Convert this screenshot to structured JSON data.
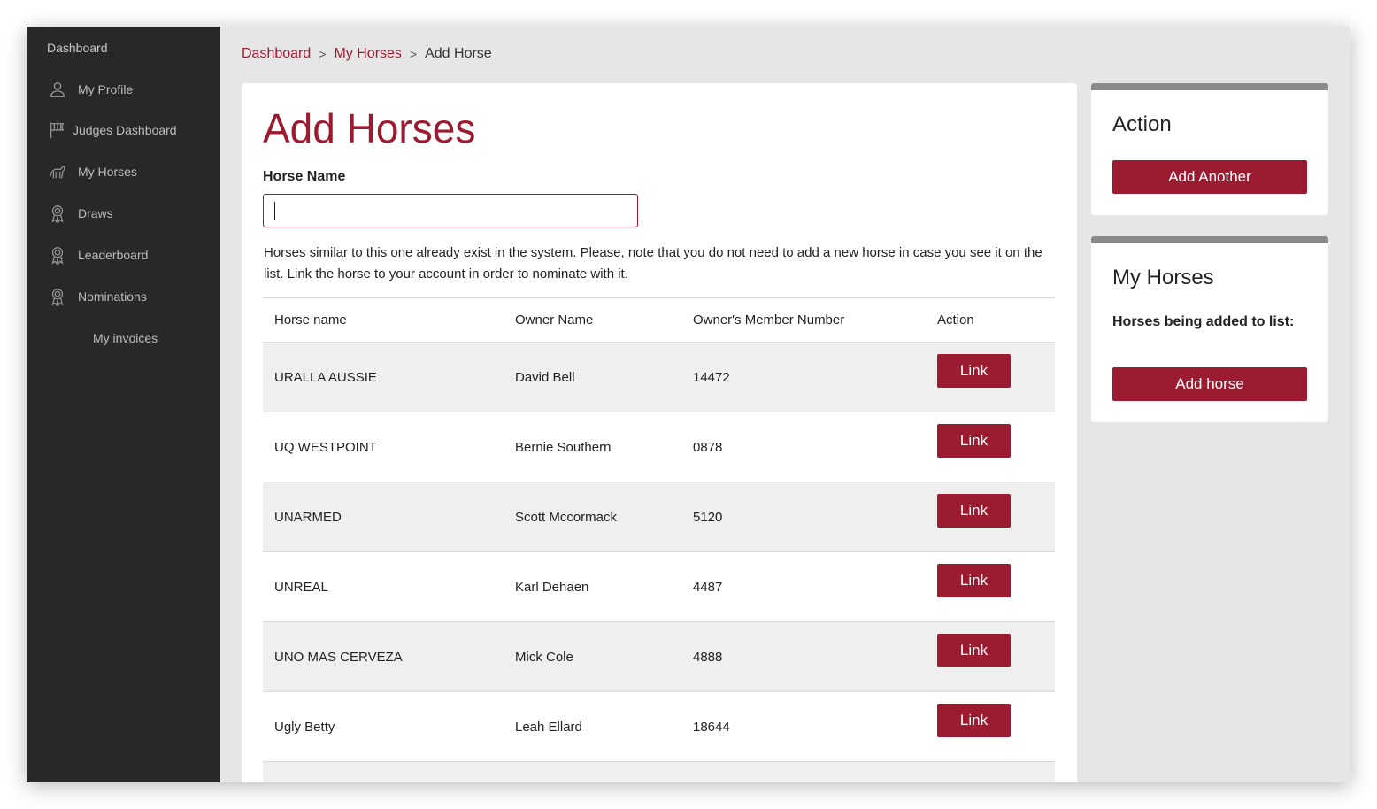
{
  "sidebar": {
    "header": "Dashboard",
    "items": [
      {
        "label": "My Profile",
        "icon": "user-icon"
      },
      {
        "label": "Judges Dashboard",
        "icon": "flag-icon"
      },
      {
        "label": "My Horses",
        "icon": "horse-icon"
      },
      {
        "label": "Draws",
        "icon": "ribbon-icon"
      },
      {
        "label": "Leaderboard",
        "icon": "ribbon-icon"
      },
      {
        "label": "Nominations",
        "icon": "ribbon-icon"
      },
      {
        "label": "My invoices",
        "icon": ""
      }
    ]
  },
  "breadcrumb": {
    "items": [
      "Dashboard",
      "My Horses",
      "Add Horse"
    ],
    "separator": ">"
  },
  "main": {
    "title": "Add Horses",
    "field_label": "Horse Name",
    "input_value": "",
    "notice": "Horses similar to this one already exist in the system. Please, note that you do not need to add a new horse in case you see it on the list. Link the horse to your account in order to nominate with it.",
    "table": {
      "headers": [
        "Horse name",
        "Owner Name",
        "Owner's Member Number",
        "Action"
      ],
      "rows": [
        {
          "horse": "URALLA AUSSIE",
          "owner": "David Bell",
          "member": "14472",
          "action": "Link"
        },
        {
          "horse": "UQ WESTPOINT",
          "owner": "Bernie Southern",
          "member": "0878",
          "action": "Link"
        },
        {
          "horse": "UNARMED",
          "owner": "Scott Mccormack",
          "member": "5120",
          "action": "Link"
        },
        {
          "horse": "UNREAL",
          "owner": "Karl Dehaen",
          "member": "4487",
          "action": "Link"
        },
        {
          "horse": "UNO MAS CERVEZA",
          "owner": "Mick Cole",
          "member": "4888",
          "action": "Link"
        },
        {
          "horse": "Ugly Betty",
          "owner": "Leah Ellard",
          "member": "18644",
          "action": "Link"
        },
        {
          "horse": "",
          "owner": "",
          "member": "",
          "action": ""
        }
      ]
    }
  },
  "action_card": {
    "title": "Action",
    "button": "Add Another"
  },
  "my_horses_card": {
    "title": "My Horses",
    "subtitle": "Horses being added to list:",
    "button": "Add horse"
  },
  "colors": {
    "accent": "#9b1b30",
    "sidebar_bg": "#282828",
    "card_top_border": "#8a8a8a"
  }
}
